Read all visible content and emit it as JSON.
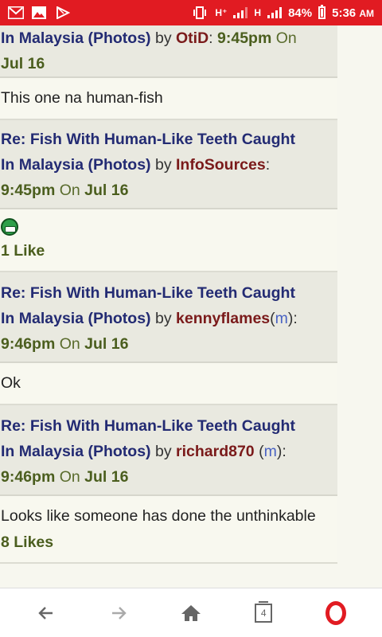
{
  "status_bar": {
    "network_1": "H⁺",
    "network_2": "H",
    "battery": "84%",
    "time": "5:36",
    "ampm": "AM",
    "icons": [
      "gmail-icon",
      "gallery-icon",
      "play-store-icon",
      "vibrate-icon",
      "signal-icon",
      "battery-icon"
    ]
  },
  "posts": [
    {
      "header": {
        "title_partial": "In Malaysia (Photos)",
        "by": "by",
        "user": "OtiD",
        "colon": ":",
        "time": "9:45pm",
        "on": "On",
        "date": "Jul 16"
      },
      "body": "This one na human-fish"
    },
    {
      "header": {
        "title_line1": "Re: Fish With Human-Like Teeth Caught",
        "title_line2": "In Malaysia (Photos)",
        "by": "by",
        "user": "InfoSources",
        "colon": ":",
        "time": "9:45pm",
        "on": "On",
        "date": "Jul 16"
      },
      "body_emoji": "grin-emoji",
      "likes": "1 Like"
    },
    {
      "header": {
        "title_line1": "Re: Fish With Human-Like Teeth Caught",
        "title_line2": "In Malaysia (Photos)",
        "by": "by",
        "user": "kennyflames",
        "mod_open": "(",
        "mod": "m",
        "mod_close": "):",
        "time": "9:46pm",
        "on": "On",
        "date": "Jul 16"
      },
      "body": "Ok"
    },
    {
      "header": {
        "title_line1": "Re: Fish With Human-Like Teeth Caught",
        "title_line2": "In Malaysia (Photos)",
        "by": "by",
        "user": "richard870",
        "mod_open": "(",
        "mod": "m",
        "mod_close": "):",
        "time": "9:46pm",
        "on": "On",
        "date": "Jul 16"
      },
      "body": "Looks like someone has done the unthinkable",
      "likes": "8 Likes"
    }
  ],
  "nav": {
    "back": "←",
    "forward": "→",
    "home": "⌂",
    "tab_count": "4"
  },
  "colors": {
    "status_bar": "#e11b22",
    "title": "#232b73",
    "user": "#7a1a1a",
    "time": "#4b5e1e",
    "mod": "#4a63c3"
  }
}
